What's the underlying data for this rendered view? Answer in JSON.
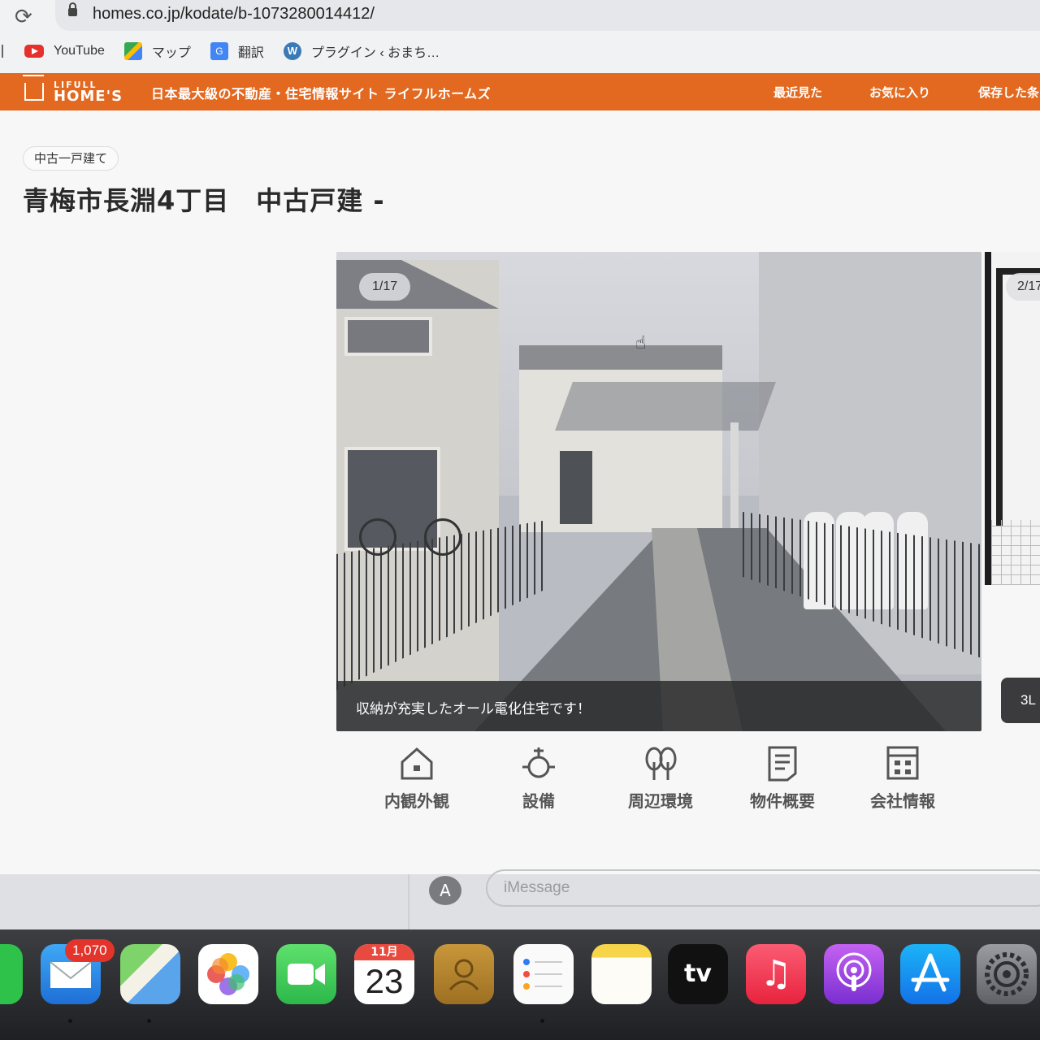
{
  "browser": {
    "url": "homes.co.jp/kodate/b-1073280014412/",
    "bookmarks": [
      {
        "label": "YouTube",
        "icon": "youtube-icon"
      },
      {
        "label": "マップ",
        "icon": "maps-icon"
      },
      {
        "label": "翻訳",
        "icon": "translate-icon"
      },
      {
        "label": "プラグイン ‹ おまち…",
        "icon": "wordpress-icon"
      }
    ]
  },
  "site": {
    "logo_small": "LIFULL",
    "logo_big": "HOME'S",
    "tagline": "日本最大級の不動産・住宅情報サイト ライフルホームズ",
    "nav": [
      "最近見た",
      "お気に入り",
      "保存した条"
    ],
    "accent_color": "#e2691f"
  },
  "listing": {
    "category": "中古一戸建て",
    "title": "青梅市長淵4丁目　中古戸建 -",
    "photo": {
      "counter": "1/17",
      "caption": "収納が充実したオール電化住宅です！"
    },
    "next_photo": {
      "counter": "2/17",
      "caption": "3L"
    },
    "categories": [
      {
        "label": "内観外観",
        "icon": "house-icon"
      },
      {
        "label": "設備",
        "icon": "equipment-icon"
      },
      {
        "label": "周辺環境",
        "icon": "trees-icon"
      },
      {
        "label": "物件概要",
        "icon": "document-icon"
      },
      {
        "label": "会社情報",
        "icon": "building-icon"
      }
    ]
  },
  "messages": {
    "placeholder": "iMessage"
  },
  "dock": {
    "mail_badge": "1,070",
    "calendar_month": "11月",
    "calendar_day": "23",
    "tv_label": "tv"
  }
}
